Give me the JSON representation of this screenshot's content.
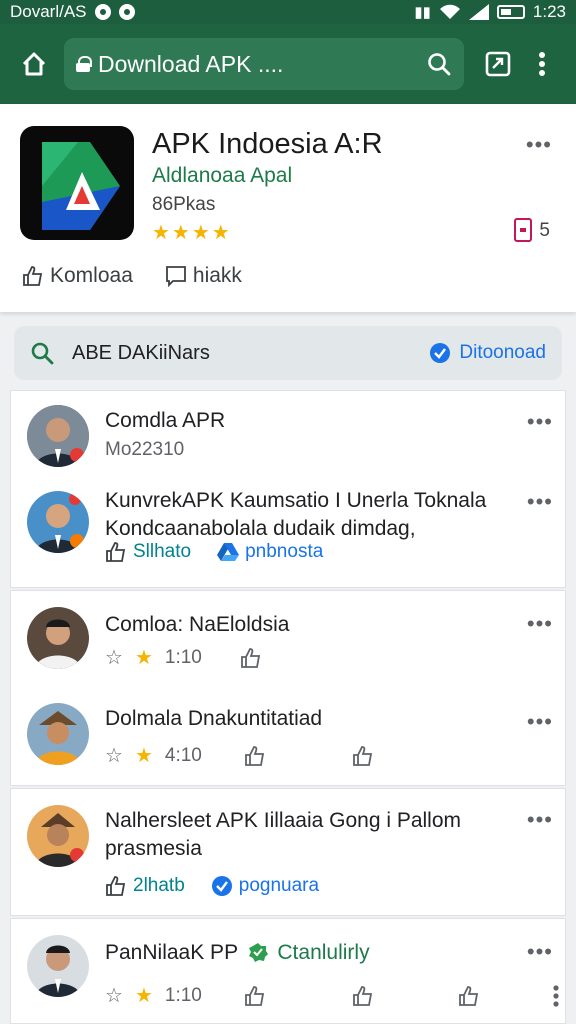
{
  "status_bar": {
    "left_text": "Dovarl/AS",
    "time": "1:23"
  },
  "toolbar": {
    "url": "Download APK ...."
  },
  "app": {
    "title": "APK Indoesia A:R",
    "subtitle": "Aldlanoaa Apal",
    "meta": "86Pkas",
    "stars": "★★★★",
    "badge_count": "5",
    "actions": [
      {
        "label": "Komloaa"
      },
      {
        "label": "hiakk"
      }
    ]
  },
  "search": {
    "label": "ABE DAKiiNars",
    "right_label": "Ditoonoad"
  },
  "posts": {
    "p1": {
      "name": "Comdla APR",
      "meta": "Mo22310"
    },
    "p2": {
      "text": "KunvrekAPK Kaumsatio I Unerla Toknala Kondcaanabolala dudaik dimdag,",
      "action1": "Sllhato",
      "action2": "pnbnosta"
    },
    "p3": {
      "name": "Comloa: NaEloldsia",
      "rating": "1:10"
    },
    "p4": {
      "name": "Dolmala Dnakuntitatiad",
      "rating": "4:10"
    },
    "p5": {
      "text": "Nalhersleet APK Iillaaia Gong i Pallom prasmesia",
      "action1": "2lhatb",
      "action2": "pognuara"
    },
    "p6": {
      "name": "PanNilaaK PP",
      "tag": "Ctanlulirly",
      "rating": "1:10"
    }
  },
  "colors": {
    "toolbar": "#1e6440",
    "accent_blue": "#1a73e8",
    "star": "#f5b400",
    "teal": "#00838f"
  }
}
